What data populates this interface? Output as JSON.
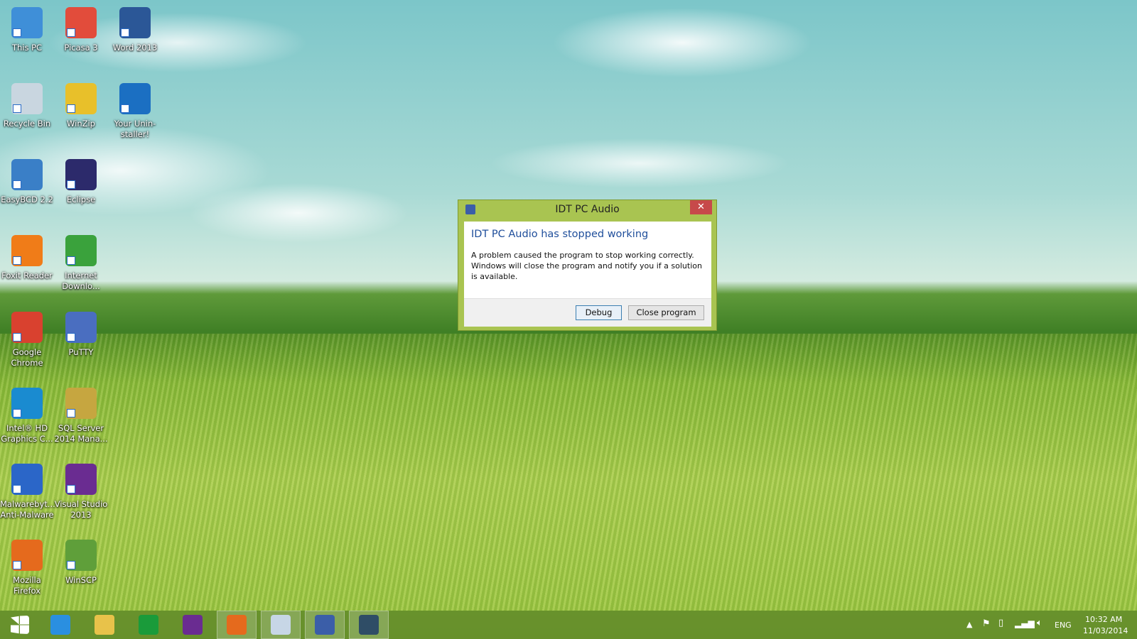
{
  "desktop_icons": [
    {
      "label": "This PC",
      "color": "#3f8fd8"
    },
    {
      "label": "Picasa 3",
      "color": "#e24c3b"
    },
    {
      "label": "Word 2013",
      "color": "#2b5797"
    },
    {
      "label": "Recycle Bin",
      "color": "#c9d6e0"
    },
    {
      "label": "WinZip",
      "color": "#e8c02a"
    },
    {
      "label": "Your Unin-staller!",
      "color": "#1b6fc2"
    },
    {
      "label": "EasyBCD 2.2",
      "color": "#3a7fc7"
    },
    {
      "label": "Eclipse",
      "color": "#2c2a6b"
    },
    {
      "label": "Foxit Reader",
      "color": "#f07c18"
    },
    {
      "label": "Internet Downlo...",
      "color": "#3aa23c"
    },
    {
      "label": "Google Chrome",
      "color": "#d9412f"
    },
    {
      "label": "PuTTY",
      "color": "#4a6ec0"
    },
    {
      "label": "Intel® HD Graphics C...",
      "color": "#1a8bd0"
    },
    {
      "label": "SQL Server 2014 Mana...",
      "color": "#c6a640"
    },
    {
      "label": "Malwarebyt... Anti-Malware",
      "color": "#2b66c8"
    },
    {
      "label": "Visual Studio 2013",
      "color": "#6a2c91"
    },
    {
      "label": "Mozilla Firefox",
      "color": "#e56a1d"
    },
    {
      "label": "WinSCP",
      "color": "#5f9f3a"
    }
  ],
  "dialog": {
    "title": "IDT PC Audio",
    "close": "✕",
    "heading": "IDT PC Audio has stopped working",
    "message": "A problem caused the program to stop working correctly. Windows will close the program and notify you if a solution is available.",
    "debug": "Debug",
    "close_program": "Close program"
  },
  "taskbar": {
    "apps": [
      {
        "name": "start",
        "color": "#ffffff"
      },
      {
        "name": "internet-explorer",
        "color": "#2a8fe0"
      },
      {
        "name": "file-explorer",
        "color": "#e8c24a"
      },
      {
        "name": "store",
        "color": "#1a9b3a"
      },
      {
        "name": "visual-studio",
        "color": "#6a2c91"
      },
      {
        "name": "firefox",
        "color": "#e56a1d"
      },
      {
        "name": "paint",
        "color": "#c7d6e6"
      },
      {
        "name": "idt-audio",
        "color": "#3b5ea8"
      },
      {
        "name": "music",
        "color": "#2f4d66"
      }
    ],
    "language": "ENG",
    "time": "10:32 AM",
    "date": "11/03/2014"
  }
}
